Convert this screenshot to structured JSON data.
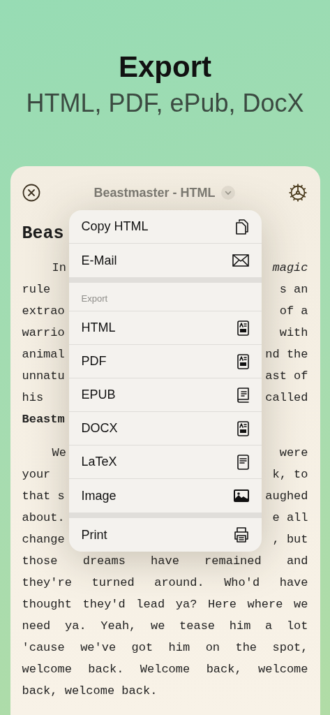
{
  "hero": {
    "title": "Export",
    "subtitle": "HTML, PDF, ePub, DocX"
  },
  "toolbar": {
    "title": "Beastmaster - HTML"
  },
  "document": {
    "heading": "Beas",
    "paragraphs": [
      {
        "lines": [
          {
            "left": "In",
            "right": "*magic*"
          },
          {
            "left": "rule",
            "right": "s an"
          },
          {
            "left": "extrao",
            "right": "of a"
          },
          {
            "left": "warrio",
            "right": "with"
          },
          {
            "left": "animal",
            "right": "nd the"
          },
          {
            "left": "unnatu",
            "right": "ast of"
          },
          {
            "left": "his",
            "right": "called"
          },
          {
            "left": "**Beastm**"
          }
        ]
      },
      {
        "lines": [
          {
            "left": "We",
            "right": "were"
          },
          {
            "left": "your",
            "right": "k, to"
          },
          {
            "left": "that s",
            "right": "aughed"
          },
          {
            "left": "about.",
            "right": "e all"
          },
          {
            "left": "change",
            "right": ", but"
          },
          {
            "text": "those dreams have remained and"
          },
          {
            "text": "they're turned around. Who'd have"
          },
          {
            "text": "thought they'd lead ya? Here where we"
          },
          {
            "text": "need ya. Yeah, we tease him a lot"
          },
          {
            "text": "'cause we've got him on the spot,"
          },
          {
            "text": "welcome back. Welcome back, welcome"
          },
          {
            "text": "back, welcome back."
          }
        ]
      }
    ]
  },
  "menu": {
    "groups": [
      {
        "items": [
          {
            "label": "Copy HTML",
            "kind": "copy"
          },
          {
            "label": "E-Mail",
            "kind": "mail"
          }
        ]
      },
      {
        "header": "Export",
        "items": [
          {
            "label": "HTML",
            "kind": "document"
          },
          {
            "label": "PDF",
            "kind": "document"
          },
          {
            "label": "EPUB",
            "kind": "book"
          },
          {
            "label": "DOCX",
            "kind": "document"
          },
          {
            "label": "LaTeX",
            "kind": "text"
          },
          {
            "label": "Image",
            "kind": "image"
          }
        ]
      },
      {
        "items": [
          {
            "label": "Print",
            "kind": "print"
          }
        ]
      }
    ]
  }
}
